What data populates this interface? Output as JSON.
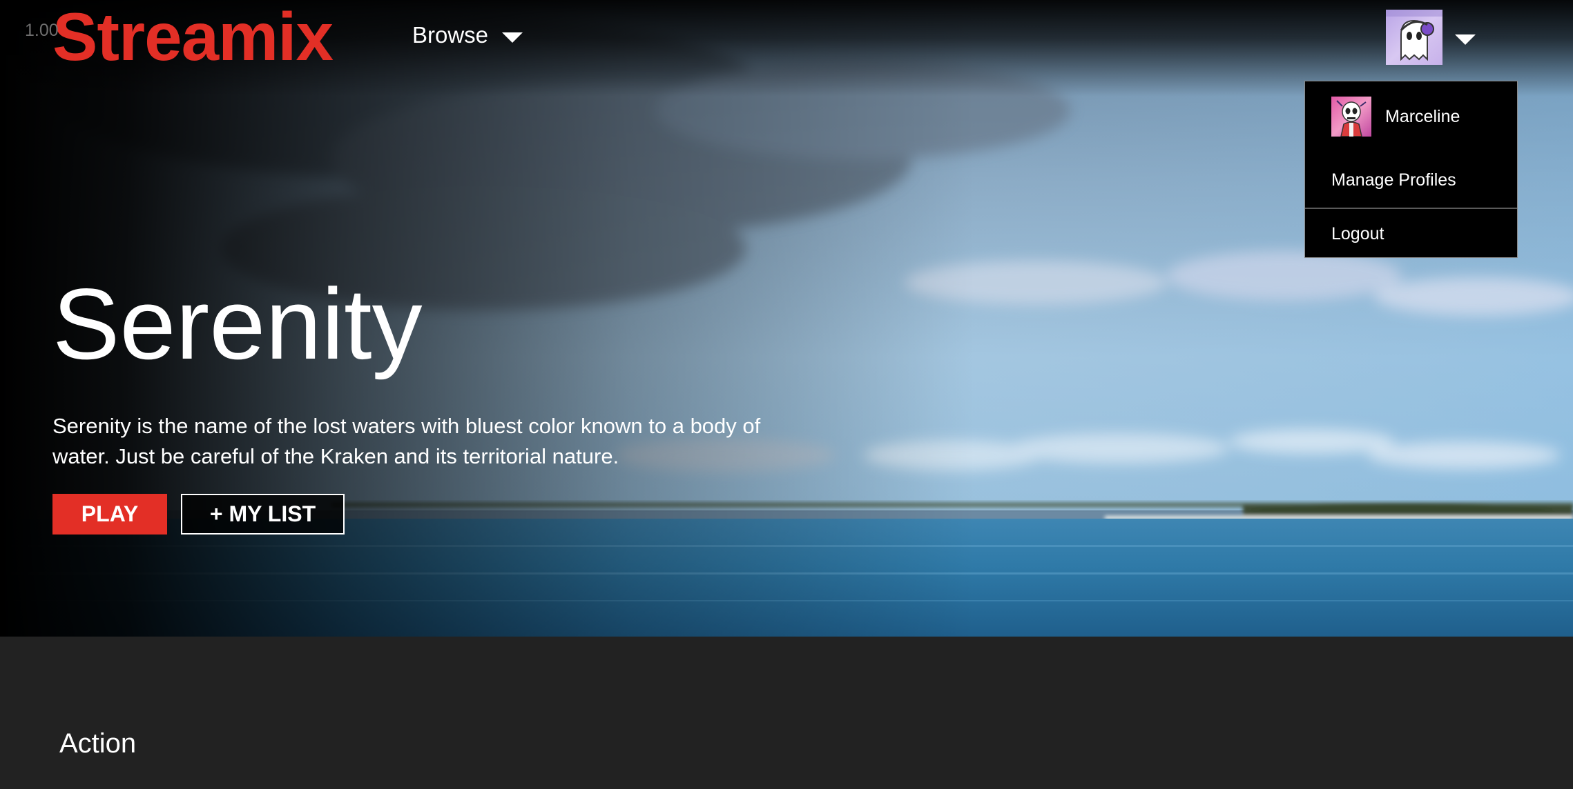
{
  "fps_counter": "1.00",
  "header": {
    "logo": "Streamix",
    "browse_label": "Browse"
  },
  "profile_menu": {
    "profile_name": "Marceline",
    "manage_profiles": "Manage Profiles",
    "logout": "Logout"
  },
  "hero": {
    "title": "Serenity",
    "description": "Serenity is the name of the lost waters with bluest color known to a body of water. Just be careful of the Kraken and its territorial nature.",
    "play_label": "PLAY",
    "my_list_label": "+ MY LIST"
  },
  "rows": [
    {
      "title": "Action"
    }
  ],
  "colors": {
    "brand_red": "#e32f26",
    "page_background": "#222222",
    "dropdown_background": "#000000"
  },
  "icons": {
    "browse_caret": "caret-down-icon",
    "profile_caret": "caret-down-icon",
    "avatar": "ghost-avatar-icon",
    "profile_avatar": "skeleton-avatar-icon"
  }
}
